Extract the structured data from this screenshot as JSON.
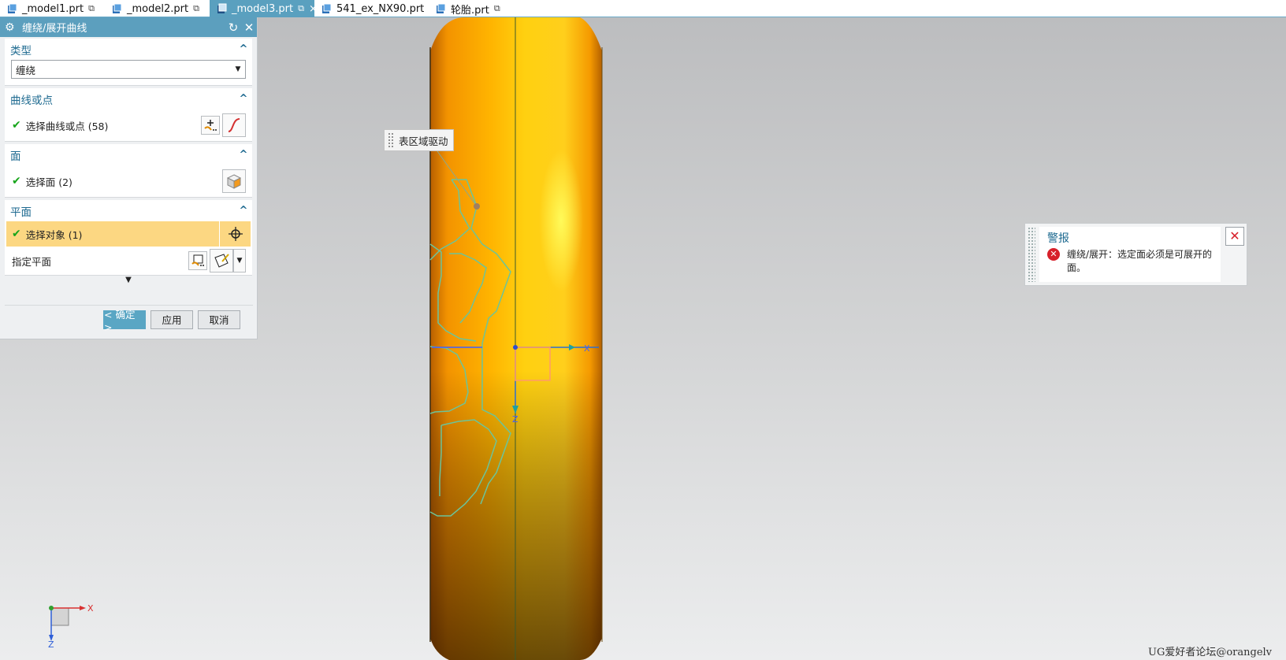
{
  "tabs": [
    {
      "label": "_model1.prt",
      "active": false
    },
    {
      "label": "_model2.prt",
      "active": false
    },
    {
      "label": "_model3.prt",
      "active": true
    },
    {
      "label": "541_ex_NX90.prt",
      "active": false
    },
    {
      "label": "轮胎.prt",
      "active": false
    }
  ],
  "dialog": {
    "title": "缠绕/展开曲线",
    "type_group": {
      "header": "类型",
      "selected": "缠绕"
    },
    "curve_group": {
      "header": "曲线或点",
      "select_label": "选择曲线或点 (58)"
    },
    "face_group": {
      "header": "面",
      "select_label": "选择面 (2)"
    },
    "plane_group": {
      "header": "平面",
      "select_label": "选择对象 (1)",
      "specify_label": "指定平面"
    },
    "buttons": {
      "ok": "< 确定 >",
      "apply": "应用",
      "cancel": "取消"
    }
  },
  "viewport": {
    "drive_label": "表区域驱动",
    "axis_x": "X",
    "axis_z": "Z",
    "csys_x": "X",
    "csys_z": "Z",
    "watermark": "UG爱好者论坛@orangelv"
  },
  "alert": {
    "title": "警报",
    "message": "缠绕/展开：选定面必须是可展开的面。"
  },
  "colors": {
    "accent": "#5c9fbe",
    "tire_light": "#ffd21a",
    "tire_dark": "#6a3c08",
    "highlight_row": "#fcd782",
    "curve_green": "#5fbd8a"
  }
}
